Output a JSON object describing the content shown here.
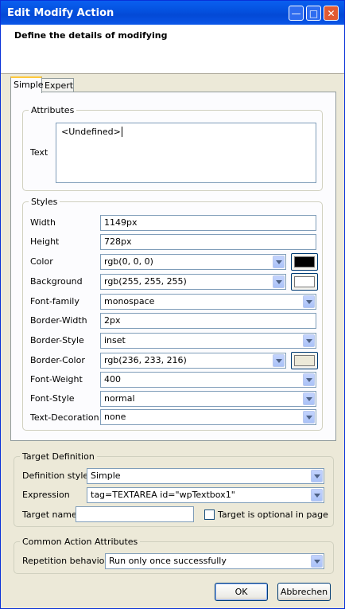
{
  "window": {
    "title": "Edit Modify Action"
  },
  "header": {
    "title": "Define the details of modifying"
  },
  "tabs": [
    {
      "label": "Simple",
      "active": true
    },
    {
      "label": "Expert",
      "active": false
    }
  ],
  "attributes": {
    "legend": "Attributes",
    "text_label": "Text",
    "text_value": "<Undefined>"
  },
  "styles": {
    "legend": "Styles",
    "rows": [
      {
        "label": "Width",
        "value": "1149px",
        "type": "text"
      },
      {
        "label": "Height",
        "value": "728px",
        "type": "text"
      },
      {
        "label": "Color",
        "value": "rgb(0, 0, 0)",
        "type": "select",
        "swatch": "#000000"
      },
      {
        "label": "Background",
        "value": "rgb(255, 255, 255)",
        "type": "select",
        "swatch": "#ffffff"
      },
      {
        "label": "Font-family",
        "value": "monospace",
        "type": "select"
      },
      {
        "label": "Border-Width",
        "value": "2px",
        "type": "text"
      },
      {
        "label": "Border-Style",
        "value": "inset",
        "type": "select"
      },
      {
        "label": "Border-Color",
        "value": "rgb(236, 233, 216)",
        "type": "select",
        "swatch": "#ece9d8"
      },
      {
        "label": "Font-Weight",
        "value": "400",
        "type": "select"
      },
      {
        "label": "Font-Style",
        "value": "normal",
        "type": "select"
      },
      {
        "label": "Text-Decoration",
        "value": "none",
        "type": "select"
      }
    ]
  },
  "target": {
    "legend": "Target Definition",
    "definition_style_label": "Definition style",
    "definition_style_value": "Simple",
    "expression_label": "Expression",
    "expression_value": "tag=TEXTAREA id=\"wpTextbox1\"",
    "target_name_label": "Target name",
    "target_name_value": "",
    "optional_label": "Target is optional in page",
    "optional_checked": false
  },
  "common": {
    "legend": "Common Action Attributes",
    "repetition_label": "Repetition behavior",
    "repetition_value": "Run only once successfully"
  },
  "buttons": {
    "ok": "OK",
    "cancel": "Abbrechen"
  }
}
